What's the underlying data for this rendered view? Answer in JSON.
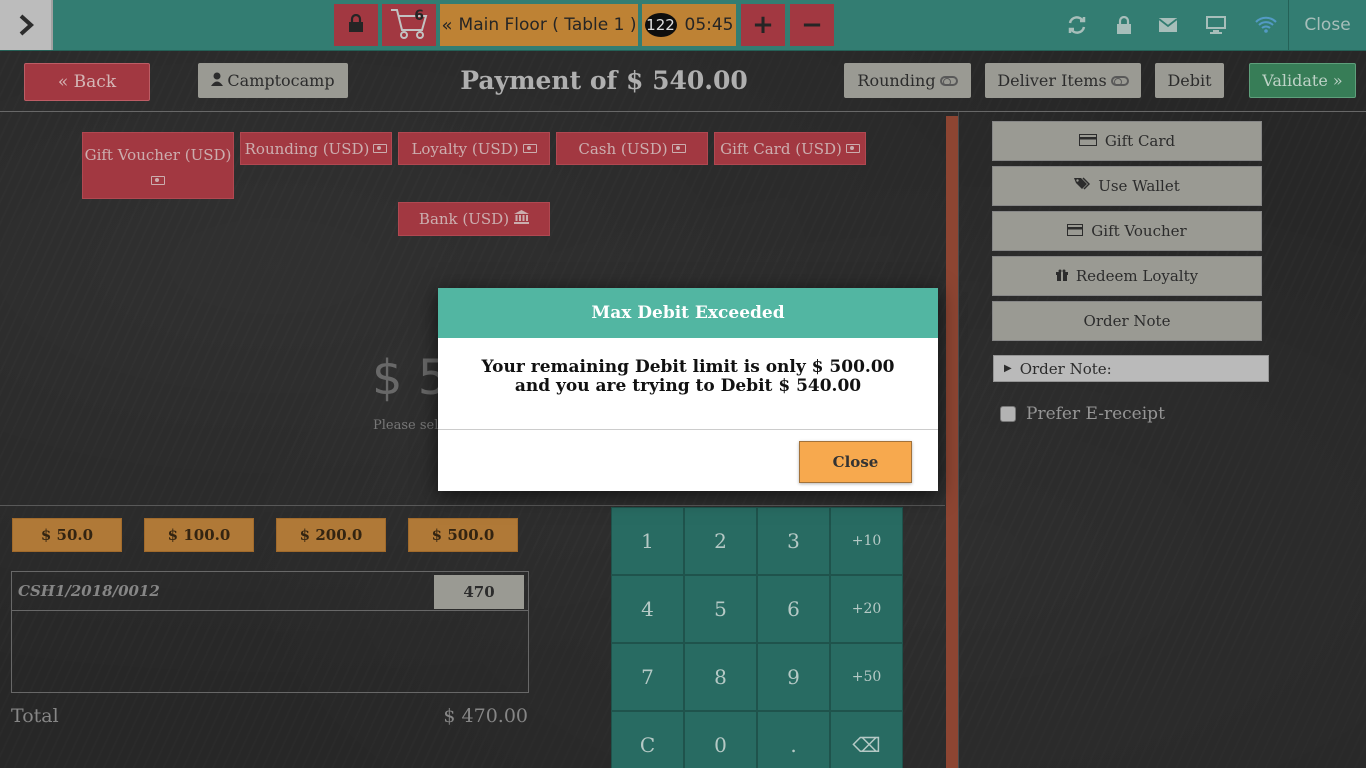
{
  "topbar": {
    "toggle_icon": "chevron-right-icon",
    "cart_count": "6",
    "floor_label": "Main Floor ( Table 1 )",
    "guest_count": "122",
    "time": "05:45",
    "plus_label": "+",
    "minus_label": "−",
    "close_label": "Close"
  },
  "header": {
    "back_label": "« Back",
    "customer_label": "Camptocamp",
    "title": "Payment of $ 540.00",
    "rounding_label": "Rounding",
    "deliver_label": "Deliver Items",
    "debit_label": "Debit",
    "validate_label": "Validate »"
  },
  "payment_methods": [
    {
      "label": "Gift Voucher (USD)"
    },
    {
      "label": "Rounding (USD)"
    },
    {
      "label": "Loyalty (USD)"
    },
    {
      "label": "Cash (USD)"
    },
    {
      "label": "Gift Card (USD)"
    },
    {
      "label": "Bank (USD)"
    }
  ],
  "center": {
    "big_amount": "$ 5",
    "hint": "Please sele"
  },
  "quick_amounts": [
    "$ 50.0",
    "$ 100.0",
    "$ 200.0",
    "$ 500.0"
  ],
  "paymentline": {
    "name": "CSH1/2018/0012",
    "value": "470"
  },
  "total": {
    "label": "Total",
    "value": "$ 470.00"
  },
  "numpad": {
    "keys": [
      "1",
      "2",
      "3",
      "+10",
      "4",
      "5",
      "6",
      "+20",
      "7",
      "8",
      "9",
      "+50",
      "C",
      "0",
      ".",
      "⌫"
    ]
  },
  "right_panel": {
    "gift_card": "Gift Card",
    "use_wallet": "Use Wallet",
    "gift_voucher": "Gift Voucher",
    "redeem_loyalty": "Redeem Loyalty",
    "order_note": "Order Note",
    "order_note_field": "Order Note:",
    "prefer_ereceipt": "Prefer E-receipt"
  },
  "modal": {
    "title": "Max Debit Exceeded",
    "line1": "Your remaining Debit limit is only $ 500.00",
    "line2": "and you are trying to Debit $ 540.00",
    "close_label": "Close"
  },
  "colors": {
    "topbar": "#3b8f82",
    "payment_method": "#b9404a",
    "quick_amount": "#c98a3f",
    "numpad": "#2e7a70",
    "modal_header": "#52b6a2",
    "modal_close": "#f7a94e",
    "validate": "#3f8f64"
  }
}
